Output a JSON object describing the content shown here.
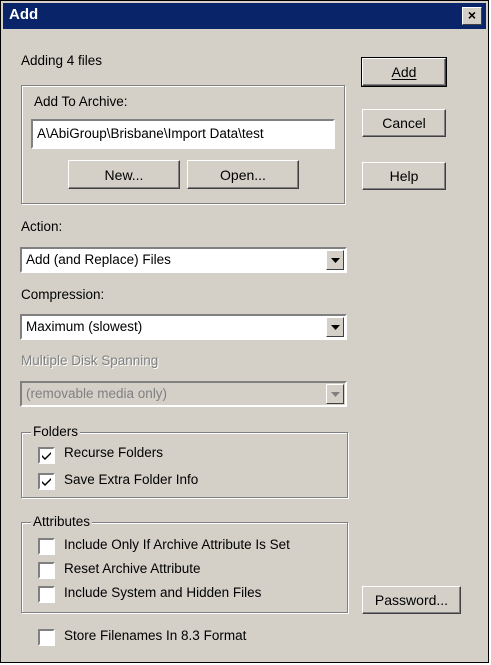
{
  "window": {
    "title": "Add",
    "close_label": "×"
  },
  "summary": "Adding 4 files",
  "buttons": {
    "add": "Add",
    "cancel": "Cancel",
    "help": "Help",
    "password": "Password...",
    "new": "New...",
    "open": "Open..."
  },
  "archive": {
    "label": "Add To Archive:",
    "path": "A\\AbiGroup\\Brisbane\\Import Data\\test"
  },
  "action": {
    "label": "Action:",
    "value": "Add (and Replace) Files"
  },
  "compression": {
    "label": "Compression:",
    "value": "Maximum (slowest)"
  },
  "spanning": {
    "label": "Multiple Disk Spanning",
    "value": "(removable media only)",
    "enabled": false
  },
  "folders": {
    "title": "Folders",
    "recurse": {
      "label": "Recurse Folders",
      "checked": true
    },
    "save_info": {
      "label": "Save Extra Folder Info",
      "checked": true
    }
  },
  "attributes": {
    "title": "Attributes",
    "archive_only": {
      "label": "Include Only If Archive Attribute Is Set",
      "checked": false
    },
    "reset": {
      "label": "Reset Archive Attribute",
      "checked": false
    },
    "system_hidden": {
      "label": "Include System and Hidden Files",
      "checked": false
    }
  },
  "store_83": {
    "label": "Store Filenames In 8.3 Format",
    "checked": false
  }
}
